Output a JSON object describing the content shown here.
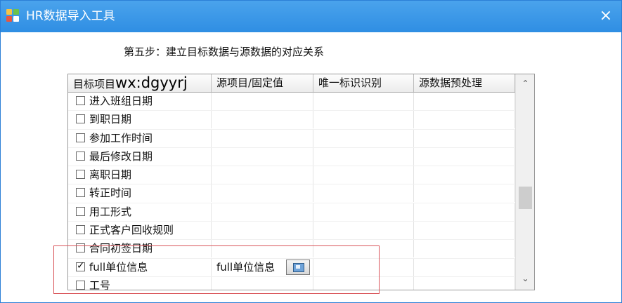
{
  "window": {
    "title": "HR数据导入工具",
    "close_symbol": "×"
  },
  "step": "第五步：建立目标数据与源数据的对应关系",
  "columns": [
    "目标项目",
    "源项目/固定值",
    "唯一标识识别",
    "源数据预处理"
  ],
  "watermark": "wx:dgyyrj",
  "rows": [
    {
      "target": "进入班组日期",
      "checked": false,
      "source": ""
    },
    {
      "target": "到职日期",
      "checked": false,
      "source": ""
    },
    {
      "target": "参加工作时间",
      "checked": false,
      "source": ""
    },
    {
      "target": "最后修改日期",
      "checked": false,
      "source": ""
    },
    {
      "target": "离职日期",
      "checked": false,
      "source": ""
    },
    {
      "target": "转正时间",
      "checked": false,
      "source": ""
    },
    {
      "target": "用工形式",
      "checked": false,
      "source": ""
    },
    {
      "target": "正式客户回收规则",
      "checked": false,
      "source": ""
    },
    {
      "target": "合同初签日期",
      "checked": false,
      "source": ""
    },
    {
      "target": "full单位信息",
      "checked": true,
      "source": "full单位信息"
    },
    {
      "target": "工号",
      "checked": false,
      "source": ""
    }
  ],
  "scrollbar": {
    "up": "⌃",
    "down": "⌄"
  },
  "colors": {
    "titlebar": "#3a97e8",
    "highlight_border": "#d9545a"
  }
}
